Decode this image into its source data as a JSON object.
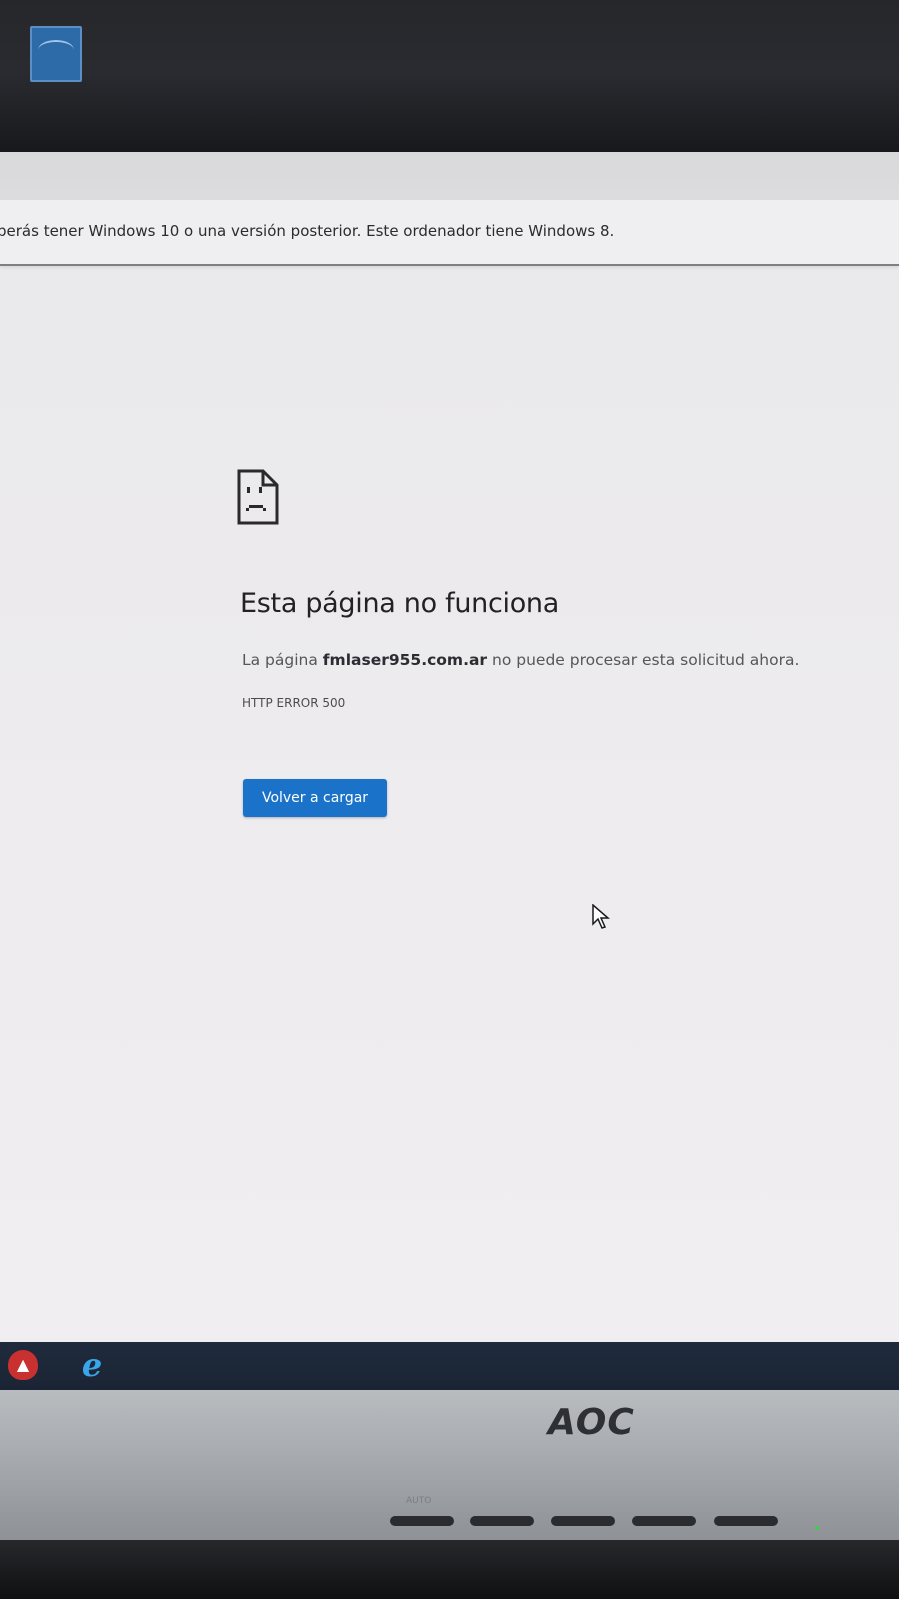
{
  "monitor": {
    "brand": "AOC",
    "buttons": [
      "AUTO",
      "",
      "",
      "",
      ""
    ]
  },
  "info_bar": {
    "message": "berás tener Windows 10 o una versión posterior. Este ordenador tiene Windows 8."
  },
  "error_page": {
    "icon": "sad-page-icon",
    "title": "Esta página no funciona",
    "desc_prefix": "La página ",
    "domain": "fmlaser955.com.ar",
    "desc_suffix": " no puede procesar esta solicitud ahora.",
    "code": "HTTP ERROR 500",
    "reload_label": "Volver a cargar",
    "accent_color": "#1a73c9"
  },
  "taskbar": {
    "apps": [
      {
        "icon": "brave-browser-icon"
      },
      {
        "icon": "internet-explorer-icon"
      }
    ]
  }
}
